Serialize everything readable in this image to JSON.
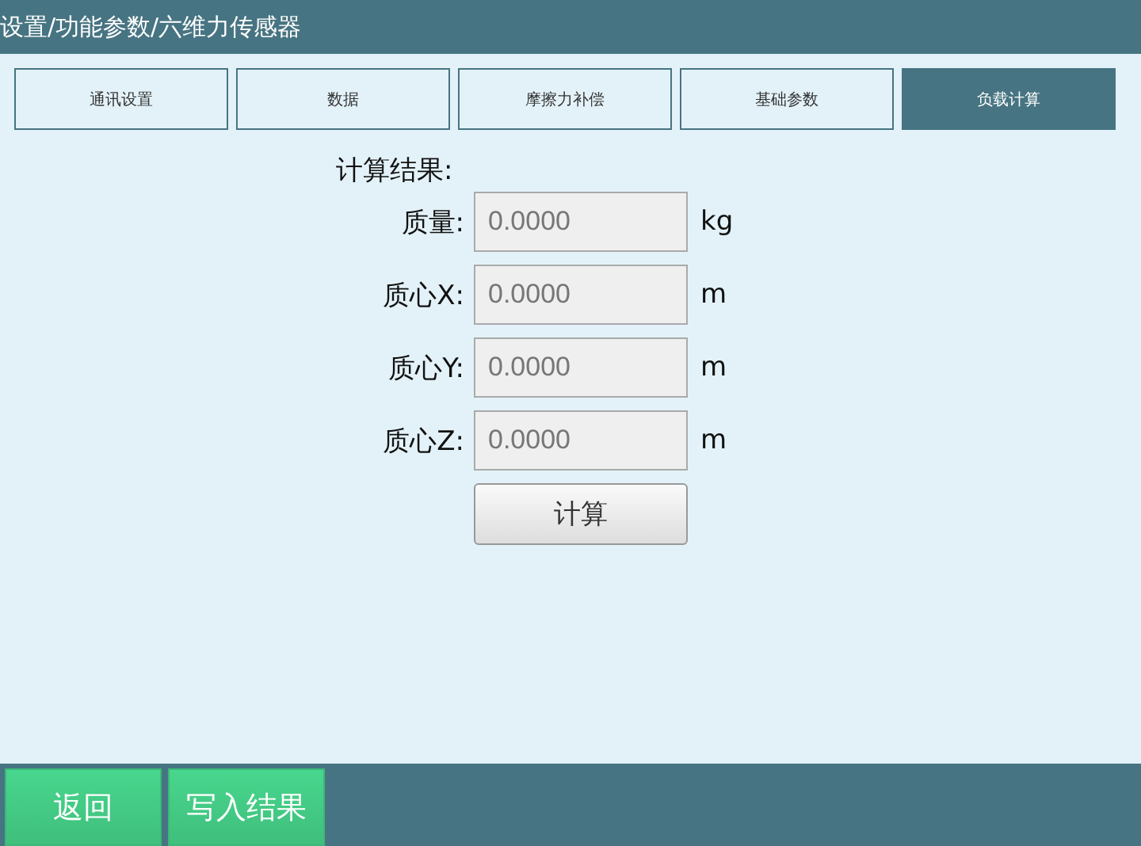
{
  "header": {
    "title": "设置/功能参数/六维力传感器"
  },
  "tabs": [
    {
      "label": "通讯设置",
      "selected": false
    },
    {
      "label": "数据",
      "selected": false
    },
    {
      "label": "摩擦力补偿",
      "selected": false
    },
    {
      "label": "基础参数",
      "selected": false
    },
    {
      "label": "负载计算",
      "selected": true
    }
  ],
  "section_title": "计算结果:",
  "fields": [
    {
      "label": "质量:",
      "value": "0.0000",
      "unit": "kg",
      "disabled": true
    },
    {
      "label": "质心X:",
      "value": "0.0000",
      "unit": "m",
      "disabled": true
    },
    {
      "label": "质心Y:",
      "value": "0.0000",
      "unit": "m",
      "disabled": true
    },
    {
      "label": "质心Z:",
      "value": "0.0000",
      "unit": "m",
      "disabled": true
    }
  ],
  "calculate_button": "计算",
  "footer_buttons": [
    "返回",
    "写入结果"
  ]
}
